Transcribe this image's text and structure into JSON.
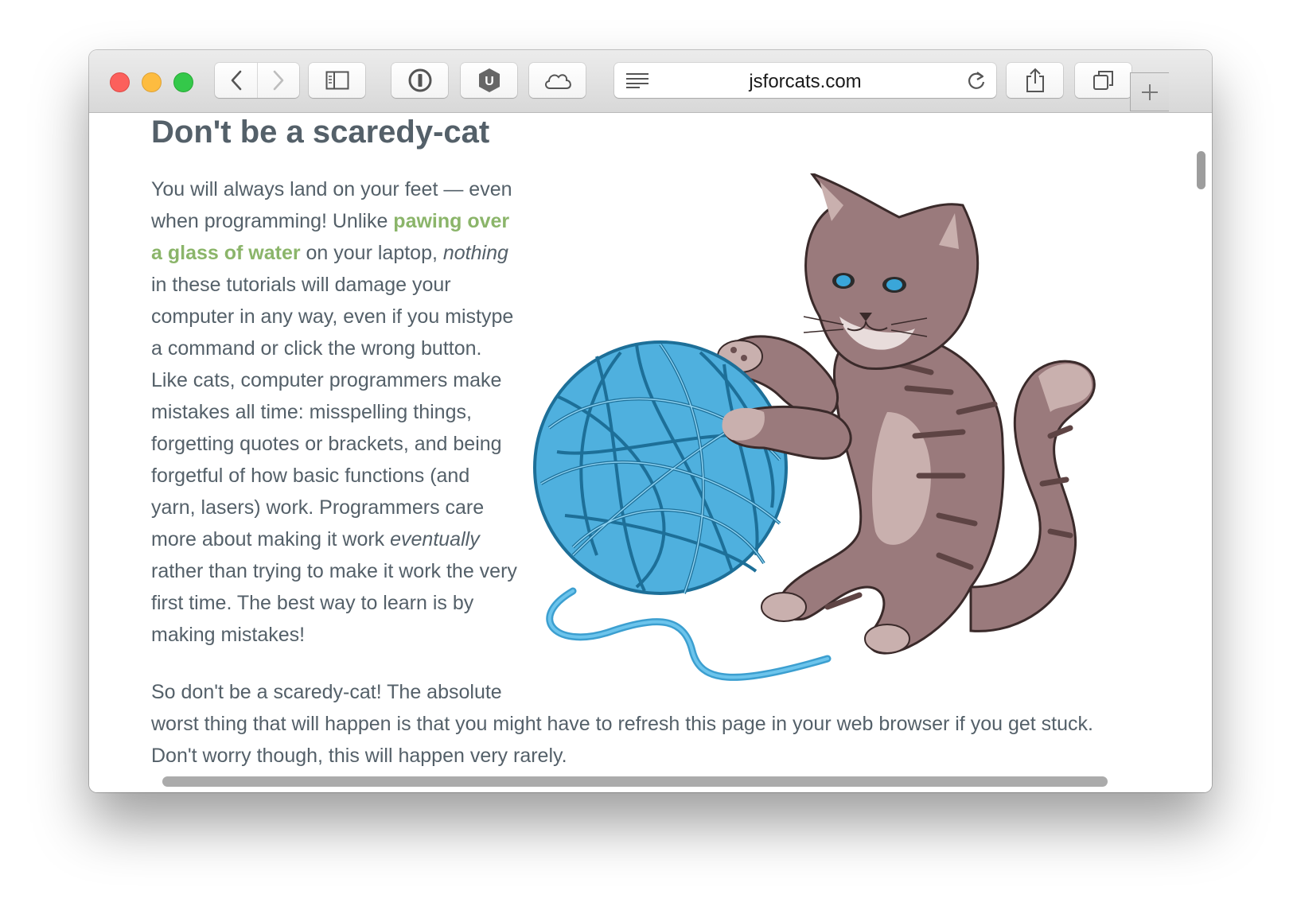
{
  "browser": {
    "url": "jsforcats.com",
    "buttons": {
      "back": "chevron-left-icon",
      "forward": "chevron-right-icon",
      "sidebar": "sidebar-icon",
      "password": "password-manager-icon",
      "extension": "U",
      "cloud": "cloud-icon",
      "reader": "reader-icon",
      "reload": "reload-icon",
      "share": "share-icon",
      "tabs": "tabs-icon",
      "new_tab": "plus-icon"
    }
  },
  "page": {
    "heading": "Don't be a scaredy-cat",
    "p1_a": "You will always land on your feet — even when programming! Unlike ",
    "p1_link": "pawing over a glass of water",
    "p1_b": " on your laptop, ",
    "p1_em1": "nothing",
    "p1_c": " in these tutorials will damage your computer in any way, even if you mistype a command or click the wrong button. Like cats, computer programmers make mistakes all time: misspelling things, forgetting quotes or brackets, and being forgetful of how basic functions (and yarn, lasers) work. Programmers care more about making it work ",
    "p1_em2": "eventually",
    "p1_d": " rather than trying to make it work the very first time. The best way to learn is by making mistakes!",
    "p2": "So don't be a scaredy-cat! The absolute worst thing that will happen is that you might have to refresh this page in your web browser if you get stuck. Don't worry though, this will happen very rarely.",
    "image": "kitten-with-yarn-ball"
  },
  "colors": {
    "heading": "#546069",
    "body_text": "#546069",
    "link": "#8bb56a",
    "yarn": "#4fb0de",
    "cat": "#9a7a7c"
  }
}
